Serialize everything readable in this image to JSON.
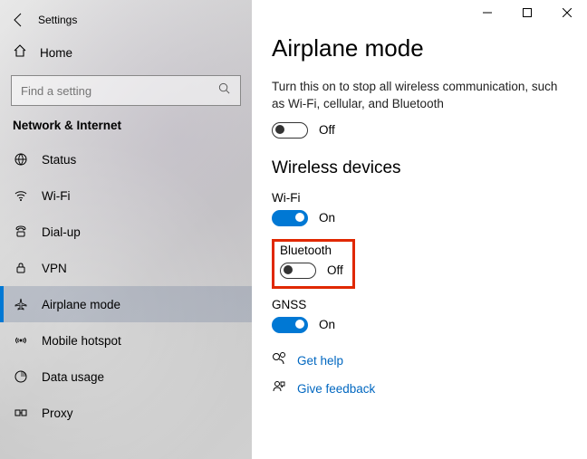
{
  "window": {
    "title": "Settings"
  },
  "home": {
    "label": "Home"
  },
  "search": {
    "placeholder": "Find a setting"
  },
  "category": "Network & Internet",
  "sidebar": {
    "items": [
      {
        "label": "Status"
      },
      {
        "label": "Wi-Fi"
      },
      {
        "label": "Dial-up"
      },
      {
        "label": "VPN"
      },
      {
        "label": "Airplane mode"
      },
      {
        "label": "Mobile hotspot"
      },
      {
        "label": "Data usage"
      },
      {
        "label": "Proxy"
      }
    ]
  },
  "page": {
    "title": "Airplane mode",
    "description": "Turn this on to stop all wireless communication, such as Wi-Fi, cellular, and Bluetooth",
    "airplane_state": "Off",
    "section": "Wireless devices",
    "devices": {
      "wifi": {
        "label": "Wi-Fi",
        "state": "On"
      },
      "bluetooth": {
        "label": "Bluetooth",
        "state": "Off"
      },
      "gnss": {
        "label": "GNSS",
        "state": "On"
      }
    },
    "help": "Get help",
    "feedback": "Give feedback"
  }
}
